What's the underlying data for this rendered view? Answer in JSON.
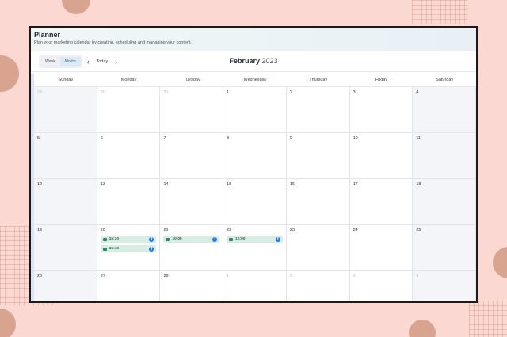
{
  "header": {
    "title": "Planner",
    "subtitle": "Plan your marketing calendar by creating, scheduling and managing your content."
  },
  "toolbar": {
    "views": [
      "Week",
      "Month"
    ],
    "active_view": "Month",
    "prev_icon": "chevron-left-icon",
    "next_icon": "chevron-right-icon",
    "today_label": "Today",
    "month": "February",
    "year": "2023"
  },
  "calendar": {
    "day_headers": [
      "Sunday",
      "Monday",
      "Tuesday",
      "Wednesday",
      "Thursday",
      "Friday",
      "Saturday"
    ],
    "weeks": [
      [
        {
          "day": "29",
          "other": true
        },
        {
          "day": "30",
          "other": true
        },
        {
          "day": "31",
          "other": true
        },
        {
          "day": "1"
        },
        {
          "day": "2"
        },
        {
          "day": "3"
        },
        {
          "day": "4"
        }
      ],
      [
        {
          "day": "5"
        },
        {
          "day": "6"
        },
        {
          "day": "7"
        },
        {
          "day": "8"
        },
        {
          "day": "9"
        },
        {
          "day": "10"
        },
        {
          "day": "11"
        }
      ],
      [
        {
          "day": "12"
        },
        {
          "day": "13"
        },
        {
          "day": "14"
        },
        {
          "day": "15"
        },
        {
          "day": "16"
        },
        {
          "day": "17"
        },
        {
          "day": "18"
        }
      ],
      [
        {
          "day": "19"
        },
        {
          "day": "20",
          "events": [
            {
              "time": "15:30",
              "network": "facebook"
            },
            {
              "time": "15:40",
              "network": "facebook"
            }
          ]
        },
        {
          "day": "21",
          "events": [
            {
              "time": "10:00",
              "network": "facebook"
            }
          ]
        },
        {
          "day": "22",
          "events": [
            {
              "time": "10:00",
              "network": "facebook"
            }
          ]
        },
        {
          "day": "23"
        },
        {
          "day": "24"
        },
        {
          "day": "25"
        }
      ],
      [
        {
          "day": "26"
        },
        {
          "day": "27"
        },
        {
          "day": "28"
        },
        {
          "day": "1",
          "other": true
        },
        {
          "day": "2",
          "other": true
        },
        {
          "day": "3",
          "other": true
        },
        {
          "day": "4",
          "other": true
        }
      ]
    ]
  },
  "colors": {
    "background": "#fbd9d2",
    "event_bg": "#d7ede4",
    "event_text": "#2b6b55",
    "facebook": "#1877f2",
    "active_view_bg": "#dce9f6"
  }
}
